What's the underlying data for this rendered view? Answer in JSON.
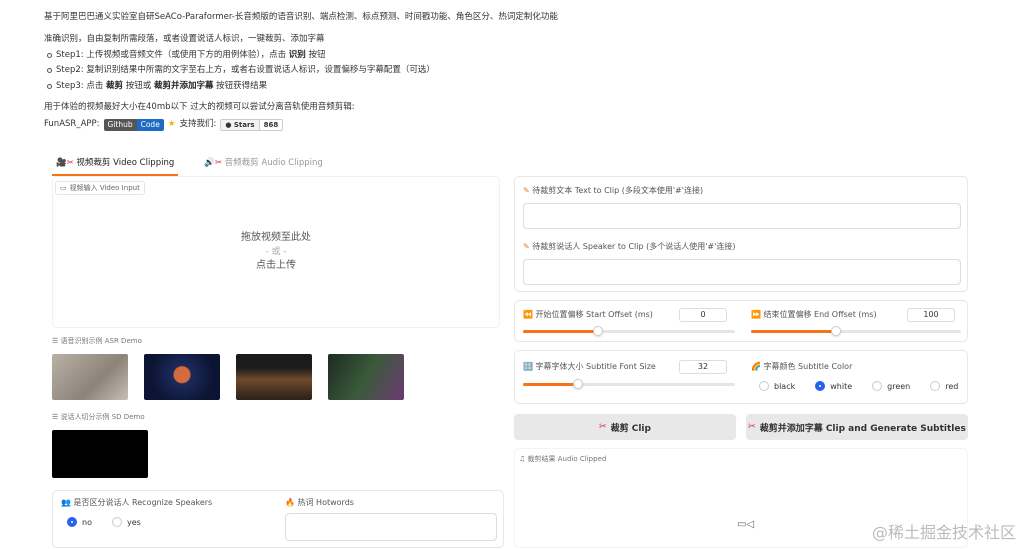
{
  "intro": {
    "line1": "基于阿里巴巴通义实验室自研SeACo-Paraformer-长音频版的语音识别、端点检测、标点预测、时间戳功能、角色区分、热词定制化功能",
    "line2": "准确识别，自由复制所需段落，或者设置说话人标识，一键裁剪、添加字幕",
    "step1_pre": "Step1: 上传视频或音频文件（或使用下方的用例体验），点击 ",
    "step1_bold": "识别",
    "step1_post": " 按钮",
    "step2": "Step2: 复制识别结果中所需的文字至右上方，或者右设置说话人标识，设置偏移与字幕配置（可选）",
    "step3_pre": "Step3: 点击 ",
    "step3_bold1": "裁剪",
    "step3_mid": " 按钮或 ",
    "step3_bold2": "裁剪并添加字幕",
    "step3_post": " 按钮获得结果",
    "line4": "用于体验的视频最好大小在40mb以下 过大的视频可以尝试分离音轨使用音频剪辑:",
    "funasr_label": "FunASR_APP:",
    "github_badge_l": "Github",
    "github_badge_r": "Code",
    "support_text": "支持我们:",
    "stars_label": "Stars",
    "stars_count": "868"
  },
  "tabs": {
    "video": "视频裁剪 Video Clipping",
    "audio": "音频裁剪 Audio Clipping"
  },
  "video_input": {
    "label": "视频输入 Video Input",
    "drop1": "拖放视频至此处",
    "drop2": "- 或 -",
    "drop3": "点击上传"
  },
  "asr_demo": {
    "label": "语音识别示例 ASR Demo"
  },
  "sd_demo": {
    "label": "说话人切分示例 SD Demo"
  },
  "recognize": {
    "title": "是否区分说话人 Recognize Speakers",
    "options": [
      "no",
      "yes"
    ],
    "selected": "no"
  },
  "hotwords": {
    "title": "热词 Hotwords"
  },
  "text_to_clip": {
    "title": "待裁剪文本 Text to Clip (多段文本使用'#'连接)"
  },
  "speaker_to_clip": {
    "title": "待裁剪说话人 Speaker to Clip (多个说话人使用'#'连接)"
  },
  "start_offset": {
    "title": "开始位置偏移 Start Offset (ms)",
    "value": "0",
    "fraction": 0.35
  },
  "end_offset": {
    "title": "结束位置偏移 End Offset (ms)",
    "value": "100",
    "fraction": 0.4
  },
  "font_size": {
    "title": "字幕字体大小 Subtitle Font Size",
    "value": "32",
    "fraction": 0.25
  },
  "subtitle_color": {
    "title": "字幕颜色 Subtitle Color",
    "options": [
      "black",
      "white",
      "green",
      "red"
    ],
    "selected": "white"
  },
  "buttons": {
    "clip": "裁剪 Clip",
    "clip_sub": "裁剪并添加字幕 Clip and Generate Subtitles"
  },
  "audio_clipped": {
    "label": "裁剪结果 Audio Clipped"
  },
  "watermark": "@稀土掘金技术社区",
  "colors": {
    "accent": "#f97316",
    "radio": "#2563eb"
  }
}
